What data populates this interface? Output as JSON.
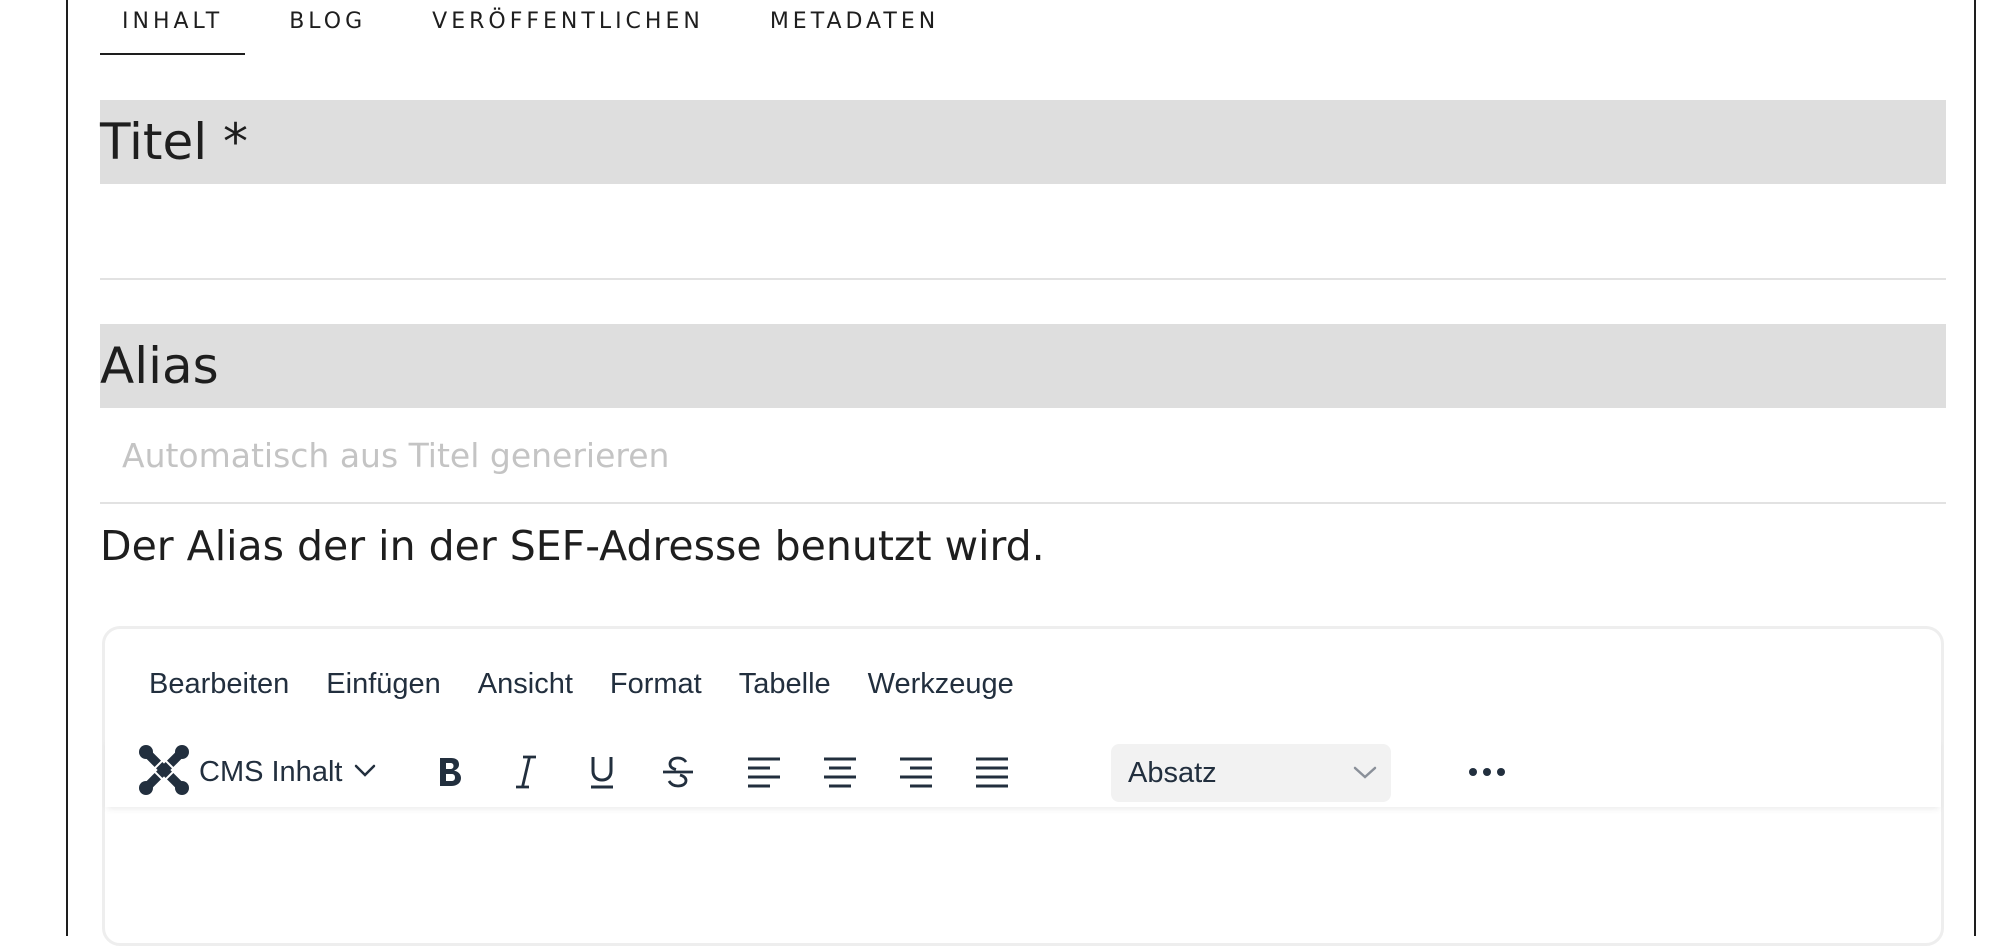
{
  "tabs": [
    {
      "label": "INHALT",
      "active": true
    },
    {
      "label": "BLOG",
      "active": false
    },
    {
      "label": "VERÖFFENTLICHEN",
      "active": false
    },
    {
      "label": "METADATEN",
      "active": false
    }
  ],
  "fields": {
    "title": {
      "label": "Titel *",
      "value": "",
      "placeholder": ""
    },
    "alias": {
      "label": "Alias",
      "value": "",
      "placeholder": "Automatisch aus Titel generieren",
      "help": "Der Alias der in der SEF-Adresse benutzt wird."
    }
  },
  "editor": {
    "menu": [
      "Bearbeiten",
      "Einfügen",
      "Ansicht",
      "Format",
      "Tabelle",
      "Werkzeuge"
    ],
    "cms_label": "CMS Inhalt",
    "block_format": "Absatz",
    "toolbar_icons": [
      "joomla-icon",
      "chevron-down-icon",
      "bold-icon",
      "italic-icon",
      "underline-icon",
      "strikethrough-icon",
      "align-left-icon",
      "align-center-icon",
      "align-right-icon",
      "align-justify-icon",
      "more-icon"
    ]
  },
  "colors": {
    "text": "#1e1e1e",
    "label_bg": "#dedede",
    "editor_text": "#222f3e",
    "placeholder": "#c4c4c4"
  }
}
